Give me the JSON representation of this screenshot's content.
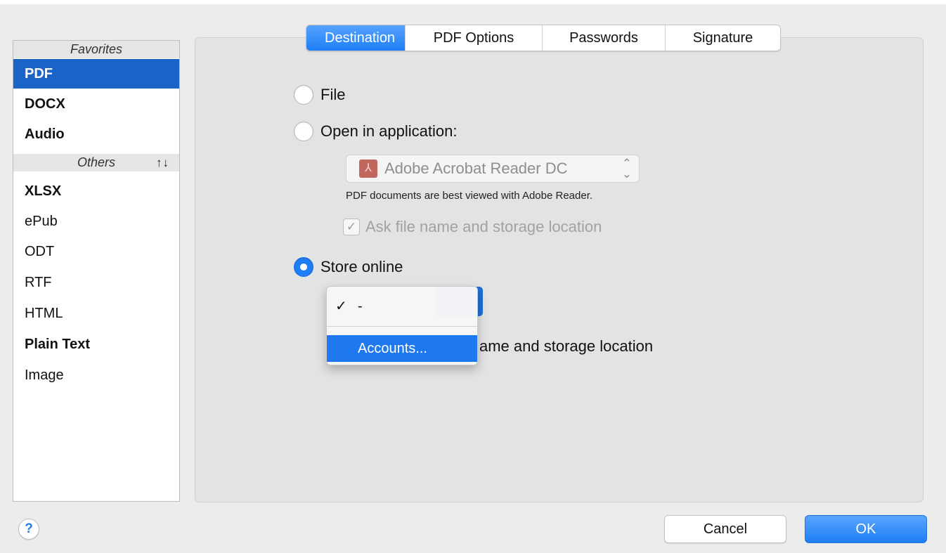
{
  "sidebar": {
    "favorites_header": "Favorites",
    "favorites": [
      {
        "label": "PDF",
        "selected": true
      },
      {
        "label": "DOCX",
        "selected": false
      },
      {
        "label": "Audio",
        "selected": false
      }
    ],
    "others_header": "Others",
    "sort_icon": "↑↓",
    "others": [
      {
        "label": "XLSX"
      },
      {
        "label": "ePub"
      },
      {
        "label": "ODT"
      },
      {
        "label": "RTF"
      },
      {
        "label": "HTML"
      },
      {
        "label": "Plain Text"
      },
      {
        "label": "Image"
      }
    ]
  },
  "tabs": [
    {
      "label": "Destination",
      "active": true
    },
    {
      "label": "PDF Options",
      "active": false
    },
    {
      "label": "Passwords",
      "active": false
    },
    {
      "label": "Signature",
      "active": false
    }
  ],
  "destination": {
    "file_label": "File",
    "open_in_app_label": "Open in application:",
    "app_select_value": "Adobe Acrobat Reader DC",
    "app_icon": "adobe-acrobat-icon",
    "app_note": "PDF documents are best viewed with Adobe Reader.",
    "ask_label_disabled": "Ask file name and storage location",
    "ask_checked": true,
    "store_online_label": "Store online",
    "store_online_selected": true,
    "ask_label_partial": "ame and storage location"
  },
  "menu": {
    "items": [
      {
        "label": "-",
        "checked": true
      },
      {
        "label": "Accounts...",
        "highlighted": true
      }
    ]
  },
  "footer": {
    "help_label": "?",
    "cancel_label": "Cancel",
    "ok_label": "OK"
  },
  "colors": {
    "accent": "#1e7ef5",
    "selection": "#1a64c8"
  }
}
